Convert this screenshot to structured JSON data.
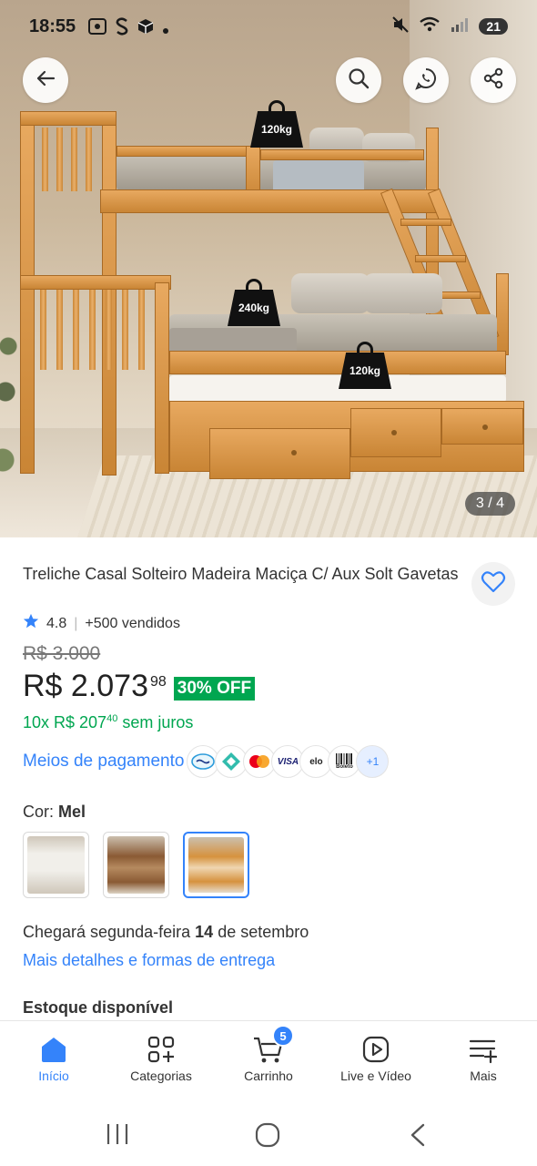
{
  "status_bar": {
    "time": "18:55",
    "battery": "21"
  },
  "product": {
    "image_counter": "3 / 4",
    "weights": [
      "120kg",
      "240kg",
      "120kg"
    ],
    "title": "Treliche Casal Solteiro Madeira Maciça C/ Aux Solt Gavetas",
    "rating": "4.8",
    "sold": "+500 vendidos",
    "old_price": "R$ 3.000",
    "price": "R$ 2.073",
    "price_cents": "98",
    "discount": "30% OFF",
    "installment_prefix": "10x R$ 207",
    "installment_cents": "40",
    "installment_suffix": "sem juros",
    "payment_link": "Meios de pagamento",
    "payment_more": "+1",
    "color_label": "Cor:",
    "color_value": "Mel",
    "delivery_prefix": "Chegará segunda-feira",
    "delivery_day": "14",
    "delivery_suffix": "de setembro",
    "delivery_link": "Mais detalhes e formas de entrega",
    "stock": "Estoque disponível"
  },
  "payment_icons": [
    "mercadopago-icon",
    "pix-icon",
    "mastercard-icon",
    "visa-icon",
    "elo-icon",
    "boleto-icon"
  ],
  "payment_labels": {
    "visa": "VISA",
    "elo": "elo",
    "boleto": "Boleto"
  },
  "swatches": [
    {
      "name": "white",
      "color": "#f1efea"
    },
    {
      "name": "brown",
      "color": "#8a5a34"
    },
    {
      "name": "mel",
      "color": "#d6923e"
    }
  ],
  "bottom_nav": {
    "items": [
      {
        "label": "Início",
        "icon": "home-icon"
      },
      {
        "label": "Categorias",
        "icon": "categories-icon"
      },
      {
        "label": "Carrinho",
        "icon": "cart-icon"
      },
      {
        "label": "Live e Vídeo",
        "icon": "play-icon"
      },
      {
        "label": "Mais",
        "icon": "menu-icon"
      }
    ],
    "cart_count": "5"
  },
  "colors": {
    "accent": "#3483fa",
    "green": "#00a650"
  }
}
